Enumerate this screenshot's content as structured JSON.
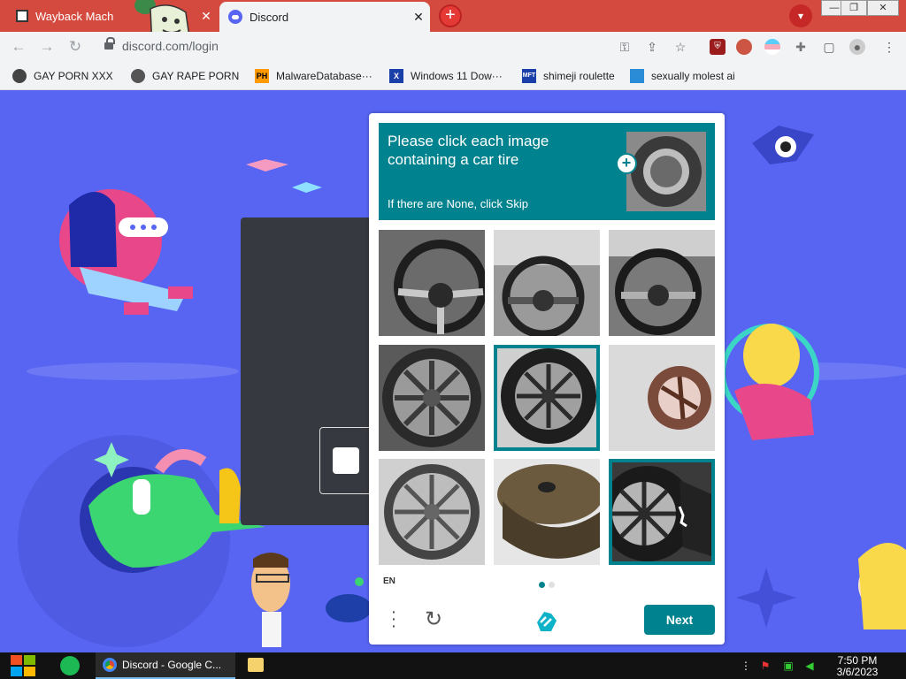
{
  "tabs": [
    {
      "title": "Wayback Mach",
      "close": "✕"
    },
    {
      "title": "Discord",
      "close": "✕"
    }
  ],
  "new_tab_symbol": "+",
  "address": {
    "url": "discord.com/login"
  },
  "bookmarks": [
    {
      "label": "GAY PORN XXX",
      "icon": "gear-icon"
    },
    {
      "label": "GAY RAPE PORN",
      "icon": "globe-icon"
    },
    {
      "label": "MalwareDatabase···",
      "icon": "ph-icon",
      "icon_text": "PH"
    },
    {
      "label": "Windows 11 Dow···",
      "icon": "x-icon",
      "icon_text": "X"
    },
    {
      "label": "shimeji roulette",
      "icon": "mft-icon",
      "icon_text": "MFT"
    },
    {
      "label": "sexually molest ai",
      "icon": "doc-icon"
    }
  ],
  "captcha": {
    "prompt": "Please click each image containing a car tire",
    "subtext": "If there are None, click Skip",
    "language": "EN",
    "next_label": "Next",
    "accent_color": "#00838f",
    "tiles": [
      {
        "content": "steering-wheel",
        "selected": false
      },
      {
        "content": "steering-wheel",
        "selected": false
      },
      {
        "content": "steering-wheel",
        "selected": false
      },
      {
        "content": "car-wheel",
        "selected": false
      },
      {
        "content": "car-wheel",
        "selected": true
      },
      {
        "content": "blurred-wheel",
        "selected": false
      },
      {
        "content": "car-wheel",
        "selected": false
      },
      {
        "content": "spool",
        "selected": false
      },
      {
        "content": "car-tire",
        "selected": true
      }
    ]
  },
  "taskbar": {
    "app_label": "Discord - Google C...",
    "time": "7:50 PM",
    "date": "3/6/2023"
  },
  "colors": {
    "page_background": "#5865f2",
    "tab_bar": "#d54a3f"
  }
}
